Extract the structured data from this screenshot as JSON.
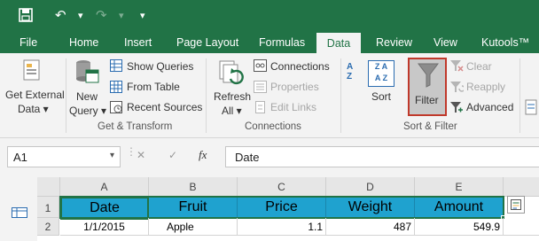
{
  "quick_access": {
    "undo_glyph": "↶",
    "redo_glyph": "↷",
    "dropdown_glyph": "▾"
  },
  "tabs": [
    "File",
    "Home",
    "Insert",
    "Page Layout",
    "Formulas",
    "Data",
    "Review",
    "View",
    "Kutools™"
  ],
  "active_tab": "Data",
  "ribbon": {
    "get_external_data": {
      "line1": "Get External",
      "line2": "Data ▾"
    },
    "new_query": {
      "line1": "New",
      "line2": "Query ▾"
    },
    "show_queries": "Show Queries",
    "from_table": "From Table",
    "recent_sources": "Recent Sources",
    "group_get_transform": "Get & Transform",
    "refresh_all": {
      "line1": "Refresh",
      "line2": "All ▾"
    },
    "connections": "Connections",
    "properties": "Properties",
    "edit_links": "Edit Links",
    "group_connections": "Connections",
    "sort": "Sort",
    "filter": "Filter",
    "clear": "Clear",
    "reapply": "Reapply",
    "advanced": "Advanced",
    "group_sort_filter": "Sort & Filter",
    "sort_az_top": "A",
    "sort_az_bottom": "Z",
    "sort_box_top": "Z A",
    "sort_box_bottom": "A Z"
  },
  "formula_bar": {
    "name_box": "A1",
    "fx": "fx",
    "cancel": "✕",
    "enter": "✓",
    "content": "Date"
  },
  "grid": {
    "columns": [
      "A",
      "B",
      "C",
      "D",
      "E"
    ],
    "rows": [
      "1",
      "2"
    ],
    "headers": [
      "Date",
      "Fruit",
      "Price",
      "Weight",
      "Amount"
    ],
    "row2": [
      "1/1/2015",
      "Apple",
      "1.1",
      "487",
      "549.9"
    ]
  },
  "colors": {
    "excel_green": "#217346",
    "header_fill": "#1fa2cf",
    "filter_highlight": "#c0392b"
  }
}
